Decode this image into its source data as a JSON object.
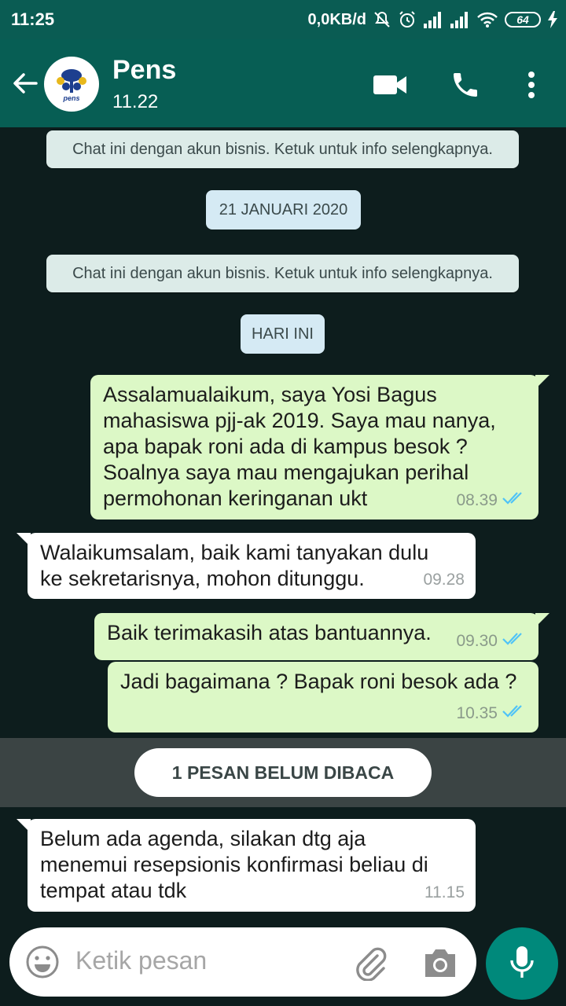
{
  "status_bar": {
    "time": "11:25",
    "network_speed": "0,0KB/d",
    "battery": "64",
    "icons": [
      "mute-icon",
      "alarm-icon",
      "signal-icon",
      "signal-icon",
      "wifi-icon",
      "battery-icon",
      "charging-icon"
    ]
  },
  "header": {
    "contact_name": "Pens",
    "contact_status": "11.22",
    "avatar_text": "pens",
    "icons": [
      "back-arrow-icon",
      "video-call-icon",
      "voice-call-icon",
      "more-vert-icon"
    ]
  },
  "chat": {
    "system_notes": [
      "Chat ini dengan akun bisnis. Ketuk untuk info selengkapnya.",
      "Chat ini dengan akun bisnis. Ketuk untuk info selengkapnya."
    ],
    "date_chips": [
      "21 JANUARI 2020",
      "HARI INI"
    ],
    "messages": [
      {
        "direction": "out",
        "lines": [
          "Assalamualaikum, saya Yosi Bagus",
          "mahasiswa pjj-ak 2019. Saya mau nanya,",
          "apa bapak roni ada di kampus besok ?",
          "Soalnya saya mau mengajukan perihal",
          "permohonan keringanan ukt"
        ],
        "time": "08.39",
        "status": "read"
      },
      {
        "direction": "in",
        "lines": [
          "Walaikumsalam, baik kami tanyakan dulu",
          "ke sekretarisnya, mohon ditunggu."
        ],
        "time": "09.28"
      },
      {
        "direction": "out",
        "lines": [
          "Baik terimakasih atas bantuannya."
        ],
        "time": "09.30",
        "status": "read"
      },
      {
        "direction": "out",
        "lines": [
          "Jadi bagaimana ? Bapak roni besok ada ?"
        ],
        "time": "10.35",
        "status": "read"
      },
      {
        "direction": "in",
        "lines": [
          "Belum ada agenda, silakan dtg aja",
          "menemui resepsionis konfirmasi beliau di",
          "tempat atau tdk"
        ],
        "time": "11.15"
      }
    ],
    "unread_label": "1 PESAN BELUM DIBACA"
  },
  "input": {
    "placeholder": "Ketik pesan",
    "icons": [
      "emoji-icon",
      "attach-icon",
      "camera-icon",
      "mic-icon"
    ]
  },
  "colors": {
    "header": "#075e54",
    "status_bar": "#0a5c53",
    "outgoing_bubble": "#dcf8c6",
    "incoming_bubble": "#ffffff",
    "read_ticks": "#4fc3f7",
    "mic_button": "#00897b"
  }
}
